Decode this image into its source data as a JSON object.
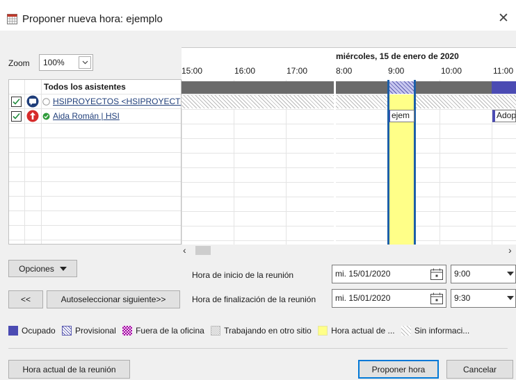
{
  "window": {
    "title": "Proponer nueva hora:  ejemplo",
    "close_glyph": "✕"
  },
  "zoom": {
    "label": "Zoom",
    "value": "100%"
  },
  "attendees": {
    "header": "Todos los asistentes",
    "rows": [
      {
        "name": "HSIPROYECTOS <HSIPROYECT(",
        "checked": true,
        "role_icon": "chat-bubble-icon",
        "status_icon": "status-unknown-icon"
      },
      {
        "name": "Aida Román | HSI",
        "checked": true,
        "role_icon": "organizer-arrow-icon",
        "status_icon": "status-available-icon"
      }
    ]
  },
  "timeline": {
    "date_label": "miércoles, 15 de enero de 2020",
    "hours": [
      "15:00",
      "16:00",
      "17:00",
      "8:00",
      "9:00",
      "10:00",
      "11:00"
    ],
    "appointments": [
      "ejem",
      "Adop"
    ]
  },
  "buttons": {
    "options": "Opciones",
    "prev": "<<",
    "autoselect_next": "Autoseleccionar siguiente>>",
    "current_time": "Hora actual de la reunión",
    "propose": "Proponer hora",
    "cancel": "Cancelar"
  },
  "meeting": {
    "start_label": "Hora de inicio de la reunión",
    "end_label": "Hora de finalización de la reunión",
    "start_date": "mi. 15/01/2020",
    "start_time": "9:00",
    "end_date": "mi. 15/01/2020",
    "end_time": "9:30"
  },
  "legend": {
    "busy": "Ocupado",
    "tentative": "Provisional",
    "out_of_office": "Fuera de la oficina",
    "working_elsewhere": "Trabajando en otro sitio",
    "current_meeting": "Hora actual de ...",
    "no_info": "Sin informaci..."
  },
  "colors": {
    "busy": "#4b4bb3",
    "meeting_highlight": "#ffff88",
    "meeting_border": "#1c5fa8",
    "out_of_office": "#9b0aa0"
  }
}
